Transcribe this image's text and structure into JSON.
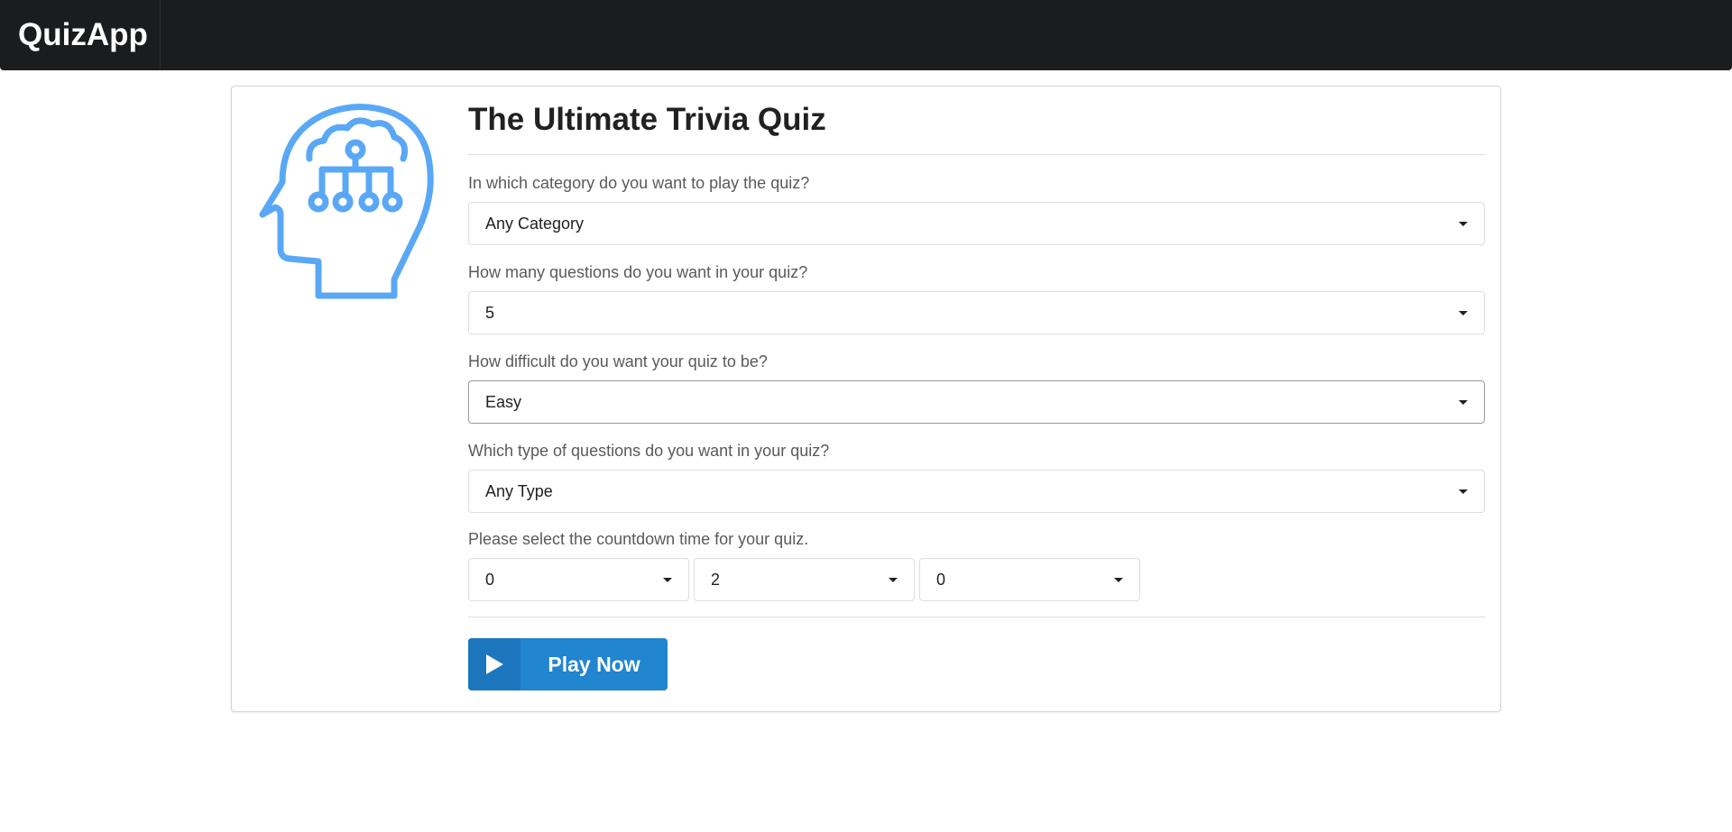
{
  "navbar": {
    "brand": "QuizApp"
  },
  "quiz": {
    "title": "The Ultimate Trivia Quiz",
    "fields": {
      "category": {
        "label": "In which category do you want to play the quiz?",
        "value": "Any Category"
      },
      "count": {
        "label": "How many questions do you want in your quiz?",
        "value": "5"
      },
      "difficulty": {
        "label": "How difficult do you want your quiz to be?",
        "value": "Easy"
      },
      "type": {
        "label": "Which type of questions do you want in your quiz?",
        "value": "Any Type"
      }
    },
    "countdown": {
      "label": "Please select the countdown time for your quiz.",
      "hours": "0",
      "minutes": "2",
      "seconds": "0"
    },
    "play_button": {
      "label": "Play Now",
      "icon": "play-icon"
    }
  },
  "icons": {
    "logo": "brain-head-icon",
    "dropdown": "caret-down-icon"
  },
  "colors": {
    "navbar_bg": "#1b1c1d",
    "accent_blue": "#2185d0",
    "logo_blue": "#5aa8f5"
  }
}
